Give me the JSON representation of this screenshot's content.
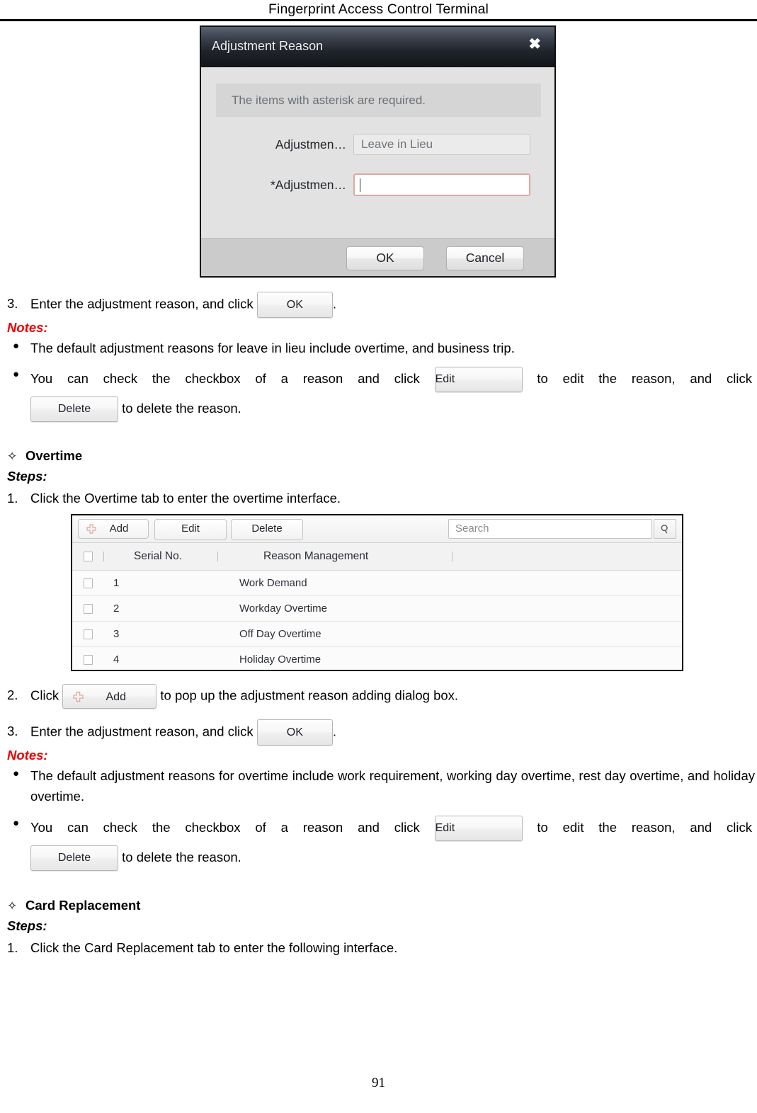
{
  "header": {
    "title": "Fingerprint Access Control Terminal"
  },
  "page_number": "91",
  "dialog": {
    "title": "Adjustment Reason",
    "close_icon": "close-icon",
    "notice": "The items with asterisk are required.",
    "fields": [
      {
        "label": "Adjustmen…",
        "value": "Leave in Lieu",
        "required": false
      },
      {
        "label": "*Adjustmen…",
        "value": "",
        "required": true
      }
    ],
    "ok_label": "OK",
    "cancel_label": "Cancel"
  },
  "section_leave_in_lieu": {
    "step3": {
      "num": "3.",
      "text_before": "Enter the adjustment reason, and click",
      "button_label": "OK",
      "text_after": "."
    },
    "notes_label": "Notes:",
    "note1": "The default adjustment reasons for leave in lieu include overtime, and business trip.",
    "note2": {
      "text_before": "You can check the checkbox of a reason and click",
      "edit_label": "Edit",
      "text_middle": "to edit the reason, and click",
      "delete_label": "Delete",
      "text_after": "to delete the reason."
    }
  },
  "section_overtime": {
    "diamond": "✧",
    "title": "Overtime",
    "steps_label": "Steps:",
    "step1": {
      "num": "1.",
      "text": "Click the Overtime tab to enter the overtime interface."
    },
    "screenshot": {
      "toolbar": {
        "add_label": "Add",
        "add_icon": "plus-icon",
        "edit_label": "Edit",
        "delete_label": "Delete",
        "search_placeholder": "Search",
        "search_icon": "magnifier-icon"
      },
      "columns": [
        "",
        "Serial No.",
        "Reason Management",
        ""
      ],
      "rows": [
        {
          "serial": "1",
          "reason": "Work Demand"
        },
        {
          "serial": "2",
          "reason": "Workday Overtime"
        },
        {
          "serial": "3",
          "reason": "Off Day Overtime"
        },
        {
          "serial": "4",
          "reason": "Holiday Overtime"
        }
      ]
    },
    "step2": {
      "num": "2.",
      "text_before": "Click",
      "button_label": "Add",
      "button_icon": "plus-icon",
      "text_after": "to pop up the adjustment reason adding dialog box."
    },
    "step3": {
      "num": "3.",
      "text_before": "Enter the adjustment reason, and click",
      "button_label": "OK",
      "text_after": "."
    },
    "notes_label": "Notes:",
    "note1": "The default adjustment reasons for overtime include work requirement, working day overtime, rest day overtime, and holiday overtime.",
    "note2": {
      "text_before": "You can check the checkbox of a reason and click",
      "edit_label": "Edit",
      "text_middle": "to edit the reason, and click",
      "delete_label": "Delete",
      "text_after": "to delete the reason."
    }
  },
  "section_card_replacement": {
    "diamond": "✧",
    "title": "Card Replacement",
    "steps_label": "Steps:",
    "step1": {
      "num": "1.",
      "text": "Click the Card Replacement tab to enter the following interface."
    }
  },
  "colors": {
    "notes_red": "#ee0000",
    "required_border": "#e0a8a2",
    "plus_icon": "#d9a8a0"
  }
}
